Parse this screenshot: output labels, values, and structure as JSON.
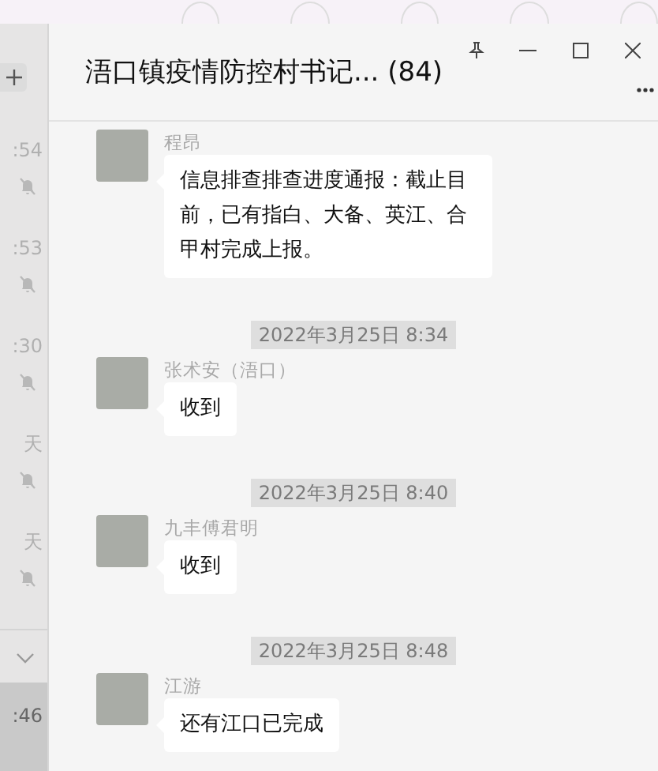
{
  "chat_list": {
    "items": [
      {
        "time": ":54",
        "muted": true
      },
      {
        "time": ":53",
        "muted": true
      },
      {
        "time": ":30",
        "muted": true
      },
      {
        "time": "天",
        "muted": true
      },
      {
        "time": "天",
        "muted": true
      }
    ],
    "active_item": {
      "time": ":46"
    }
  },
  "header": {
    "title": "浯口镇疫情防控村书记... (84)"
  },
  "messages": [
    {
      "kind": "message",
      "sender": "程昂",
      "text": "信息排查排查进度通报：截止目前，已有指白、大备、英江、合甲村完成上报。"
    },
    {
      "kind": "time",
      "text": "2022年3月25日 8:34"
    },
    {
      "kind": "message",
      "sender": "张术安（浯口）",
      "text": "收到"
    },
    {
      "kind": "time",
      "text": "2022年3月25日 8:40"
    },
    {
      "kind": "message",
      "sender": "九丰傅君明",
      "text": "收到"
    },
    {
      "kind": "time",
      "text": "2022年3月25日 8:48"
    },
    {
      "kind": "message",
      "sender": "江游",
      "text": "还有江口已完成"
    }
  ]
}
